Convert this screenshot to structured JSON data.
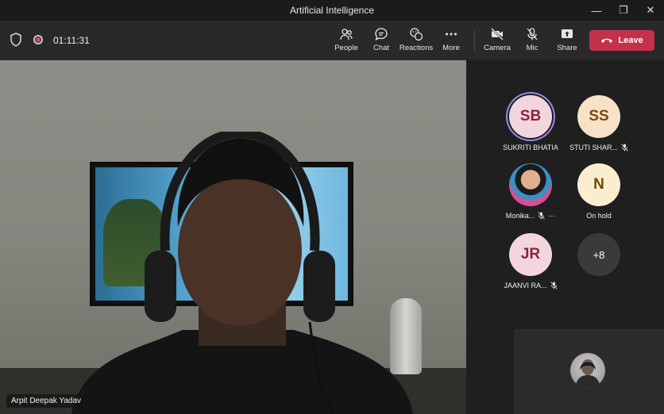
{
  "window": {
    "title": "Artificial Intelligence",
    "minimize": "—",
    "restore": "❐",
    "close": "✕"
  },
  "toolbar": {
    "timer": "01:11:31",
    "people": "People",
    "chat": "Chat",
    "reactions": "Reactions",
    "more": "More",
    "camera": "Camera",
    "mic": "Mic",
    "share": "Share",
    "leave": "Leave"
  },
  "stage": {
    "speaker_name": "Arpit Deepak Yadav"
  },
  "participants": [
    {
      "initials": "SB",
      "name": "SUKRITI BHATIA",
      "bg": "#f3d6dd",
      "fg": "#8a2440",
      "muted": false,
      "speaking": true
    },
    {
      "initials": "SS",
      "name": "STUTI SHAR...",
      "bg": "#f7e2c7",
      "fg": "#7a4a12",
      "muted": true,
      "speaking": false
    },
    {
      "initials": "",
      "name": "Monika...",
      "photo": true,
      "muted": true,
      "more": "···"
    },
    {
      "initials": "N",
      "name": "On hold",
      "bg": "#fbeed0",
      "fg": "#6e4a07",
      "muted": false
    },
    {
      "initials": "JR",
      "name": "JAANVI RA...",
      "bg": "#f3d6dd",
      "fg": "#8a2440",
      "muted": true
    },
    {
      "initials": "+8",
      "name": "",
      "bg": "#3a3a3a",
      "fg": "#ffffff",
      "overflow": true
    }
  ],
  "colors": {
    "leave": "#c4314b",
    "speaking_ring": "#8f8ee6",
    "toolbar_bg": "#292929"
  }
}
